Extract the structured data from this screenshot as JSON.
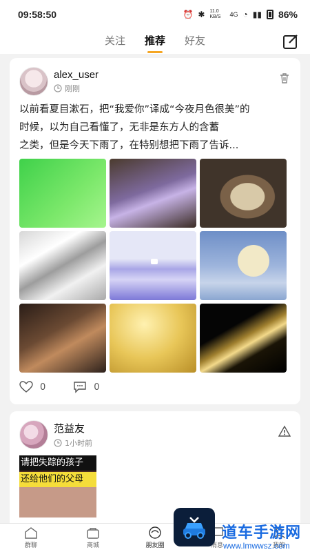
{
  "status": {
    "time": "09:58:50",
    "network": "11.0 KB/S",
    "signal": "4G",
    "battery": "86%"
  },
  "top_nav": {
    "tabs": [
      {
        "label": "关注"
      },
      {
        "label": "推荐"
      },
      {
        "label": "好友"
      }
    ],
    "active": 1
  },
  "post1": {
    "username": "alex_user",
    "time": "刚刚",
    "text_lines": [
      "以前看夏目漱石，把“我爱你”译成“今夜月色很美”的",
      "时候，以为自己看懂了，无非是东方人的含蓄",
      "之类，但是今天下雨了，在特别想把下雨了告诉..."
    ],
    "likes": "0",
    "comments": "0"
  },
  "post2": {
    "username": "范益友",
    "time": "1小时前",
    "thumb_lines": [
      "请把失踪的孩子",
      "还给他们的父母"
    ]
  },
  "bottom_nav": [
    {
      "label": "群聊",
      "icon": "home-icon"
    },
    {
      "label": "商城",
      "icon": "shop-icon"
    },
    {
      "label": "朋友圈",
      "icon": "moments-icon"
    },
    {
      "label": "消息",
      "icon": "message-icon"
    },
    {
      "label": "我的",
      "icon": "profile-icon"
    }
  ],
  "watermark": {
    "text": "道车手游网",
    "url": "www.lmwwsz.com"
  },
  "colors": {
    "accent": "#f5a623",
    "background": "#f2f2f2"
  }
}
